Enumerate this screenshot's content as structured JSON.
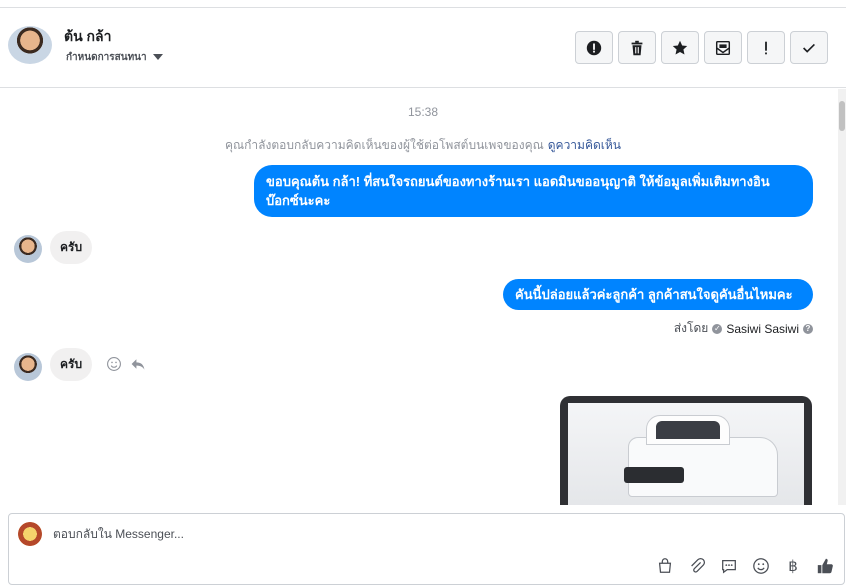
{
  "header": {
    "name": "ต้น กล้า",
    "assign_label": "กำหนดการสนทนา",
    "actions": [
      "spam-icon",
      "trash-icon",
      "star-icon",
      "mark-unread-icon",
      "important-icon",
      "done-icon"
    ]
  },
  "conversation": {
    "timestamp": "15:38",
    "notice_text": "คุณกำลังตอบกลับความคิดเห็นของผู้ใช้ต่อโพสต์บนเพจของคุณ",
    "notice_link": "ดูความคิดเห็น",
    "messages": [
      {
        "from": "page",
        "text": "ขอบคุณต้น กล้า! ที่สนใจรถยนต์ของทางร้านเรา แอดมินขออนุญาติ ให้ข้อมูลเพิ่มเติมทางอินบ๊อกซ์นะคะ"
      },
      {
        "from": "user",
        "text": "ครับ"
      },
      {
        "from": "page",
        "text": "คันนี้ปล่อยแล้วค่ะลูกค้า ลูกค้าสนใจดูคันอื่นไหมคะ"
      },
      {
        "from": "user",
        "text": "ครับ"
      }
    ],
    "sent_by_prefix": "ส่งโดย",
    "sent_by_name": "Sasiwi Sasiwi"
  },
  "composer": {
    "placeholder": "ตอบกลับใน Messenger...",
    "tools": [
      "bag-icon",
      "attach-icon",
      "saved-reply-icon",
      "emoji-icon",
      "baht-icon",
      "like-icon"
    ]
  },
  "colors": {
    "accent": "#0084ff",
    "incoming_bubble": "#f1f0f0",
    "link": "#365899"
  }
}
